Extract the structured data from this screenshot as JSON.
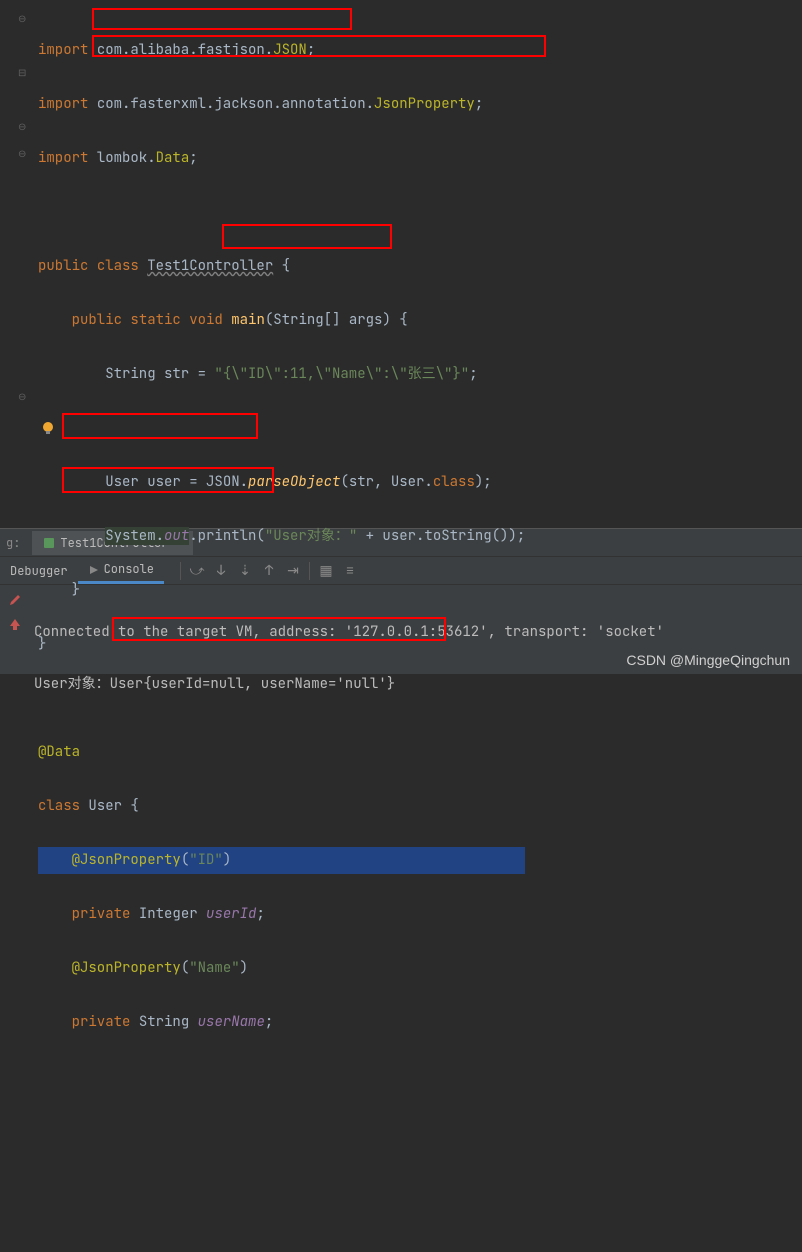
{
  "code": {
    "import_kw": "import",
    "pkg1_a": "com.alibaba.fastjson.",
    "pkg1_b": "JSON",
    "pkg2_a": "com.fasterxml.jackson.annotation.",
    "pkg2_b": "JsonProperty",
    "pkg3_a": "lombok.",
    "pkg3_b": "Data",
    "public_kw": "public",
    "class_kw": "class",
    "static_kw": "static",
    "void_kw": "void",
    "private_kw": "private",
    "class_name": "Test1Controller",
    "main": "main",
    "main_params": "(String[] args) {",
    "str_decl_a": "String str = ",
    "str_literal": "\"{\\\"ID\\\":11,\\\"Name\\\":\\\"张三\\\"}\"",
    "user_decl_a": "User user = ",
    "json_cls": "JSON",
    "parse_method": "parseObject",
    "parse_args": "(str, User.",
    "class_token": "class",
    "close_paren": ");",
    "system_cls": "System.",
    "out_field": "out",
    "println": ".println(",
    "println_str": "\"User对象：\"",
    "println_rest": " + user.toString());",
    "data_ann": "@Data",
    "user_class": "User",
    "jsonprop_ann": "@JsonProperty",
    "jp_id": "\"ID\"",
    "jp_name": "\"Name\"",
    "integer_type": "Integer",
    "string_type": "String",
    "userId_field": "userId",
    "userName_field": "userName",
    "semi": ";",
    "open_brace": " {",
    "close_brace": "}"
  },
  "run": {
    "label_g": "g:",
    "tab_name": "Test1Controller",
    "debugger_tab": "Debugger",
    "console_tab": "Console"
  },
  "console": {
    "line1": "Connected to the target VM, address: '127.0.0.1:53612', transport: 'socket'",
    "line2_a": "User对象：",
    "line2_b": "User{userId=null, userName='null'}"
  },
  "watermark": "CSDN @MinggeQingchun"
}
